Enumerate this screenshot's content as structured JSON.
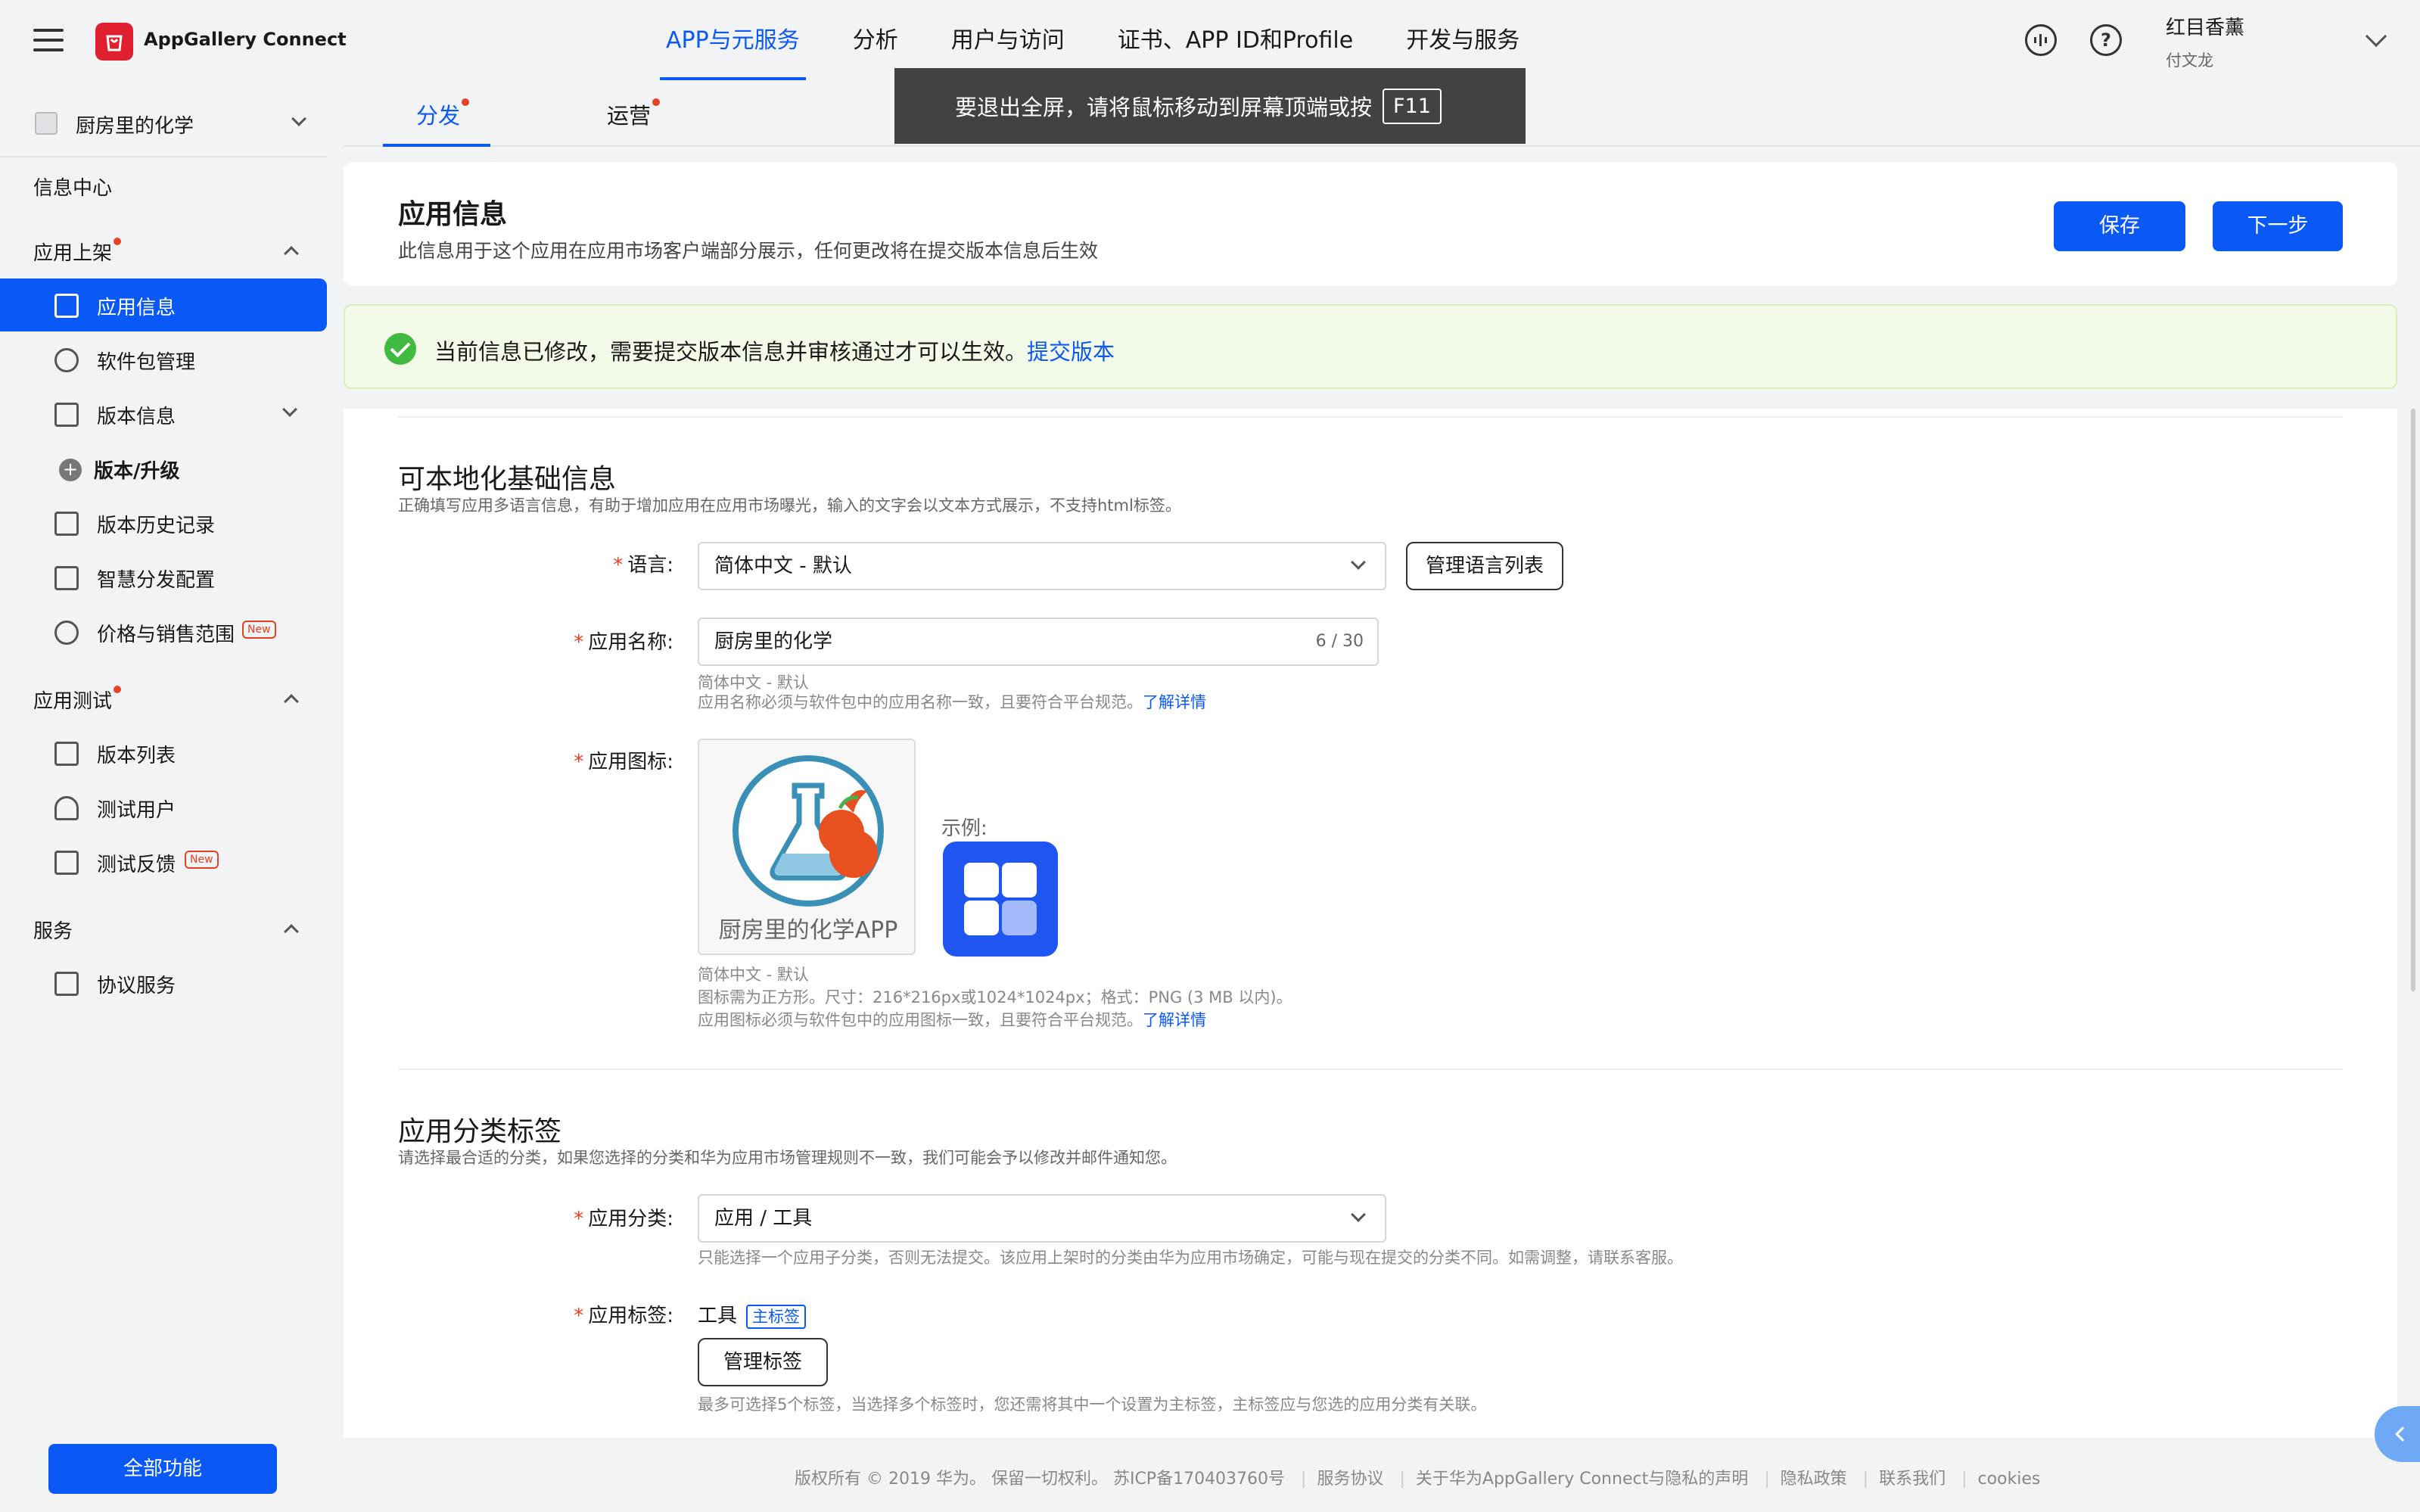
{
  "topbar": {
    "brand": "AppGallery Connect",
    "nav": [
      "APP与元服务",
      "分析",
      "用户与访问",
      "证书、APP ID和Profile",
      "开发与服务"
    ],
    "active_nav": 0,
    "user_name": "红目香薰",
    "user_sub": "付文龙",
    "help_icon": "?"
  },
  "sidebar": {
    "app_name": "厨房里的化学",
    "info_center": "信息中心",
    "sections": {
      "listing": "应用上架",
      "testing": "应用测试",
      "services": "服务"
    },
    "items": {
      "app_info": "应用信息",
      "package_mgmt": "软件包管理",
      "version_info": "版本信息",
      "version_upgrade": "版本/升级",
      "version_history": "版本历史记录",
      "smart_distribution": "智慧分发配置",
      "price_range": "价格与销售范围",
      "version_list": "版本列表",
      "test_users": "测试用户",
      "test_feedback": "测试反馈",
      "agreement_service": "协议服务"
    },
    "new_badge": "New",
    "all_functions": "全部功能"
  },
  "subtabs": [
    "分发",
    "运营"
  ],
  "toast": {
    "text": "要退出全屏，请将鼠标移动到屏幕顶端或按",
    "key": "F11"
  },
  "header": {
    "title": "应用信息",
    "desc": "此信息用于这个应用在应用市场客户端部分展示，任何更改将在提交版本信息后生效",
    "save": "保存",
    "next": "下一步"
  },
  "notice": {
    "text": "当前信息已修改，需要提交版本信息并审核通过才可以生效。",
    "link": "提交版本"
  },
  "localizable": {
    "title": "可本地化基础信息",
    "desc": "正确填写应用多语言信息，有助于增加应用在应用市场曝光，输入的文字会以文本方式展示，不支持html标签。",
    "language_label": "语言:",
    "language_value": "简体中文 - 默认",
    "manage_languages": "管理语言列表",
    "app_name_label": "应用名称:",
    "app_name_value": "厨房里的化学",
    "app_name_counter": "6 / 30",
    "app_name_hint1": "简体中文 - 默认",
    "app_name_hint2": "应用名称必须与软件包中的应用名称一致，且要符合平台规范。",
    "learn_more": "了解详情",
    "icon_label": "应用图标:",
    "icon_caption": "厨房里的化学APP",
    "example_label": "示例:",
    "icon_hint1": "简体中文 - 默认",
    "icon_hint2": "图标需为正方形。尺寸：216*216px或1024*1024px；格式：PNG (3 MB 以内)。",
    "icon_hint3": "应用图标必须与软件包中的应用图标一致，且要符合平台规范。"
  },
  "category": {
    "title": "应用分类标签",
    "desc": "请选择最合适的分类，如果您选择的分类和华为应用市场管理规则不一致，我们可能会予以修改并邮件通知您。",
    "category_label": "应用分类:",
    "category_value": "应用 / 工具",
    "category_hint": "只能选择一个应用子分类，否则无法提交。该应用上架时的分类由华为应用市场确定，可能与现在提交的分类不同。如需调整，请联系客服。",
    "tag_label": "应用标签:",
    "tag_value": "工具",
    "tag_main": "主标签",
    "manage_tags": "管理标签",
    "tag_hint": "最多可选择5个标签，当选择多个标签时，您还需将其中一个设置为主标签，主标签应与您选的应用分类有关联。"
  },
  "footer": {
    "copyright": "版权所有 © 2019 华为。 保留一切权利。 苏ICP备170403760号",
    "links": [
      "服务协议",
      "关于华为AppGallery Connect与隐私的声明",
      "隐私政策",
      "联系我们",
      "cookies"
    ]
  },
  "colors": {
    "accent": "#0a59f7",
    "required": "#e84026",
    "success": "#41ba41",
    "brand_red": "#e0202e"
  }
}
